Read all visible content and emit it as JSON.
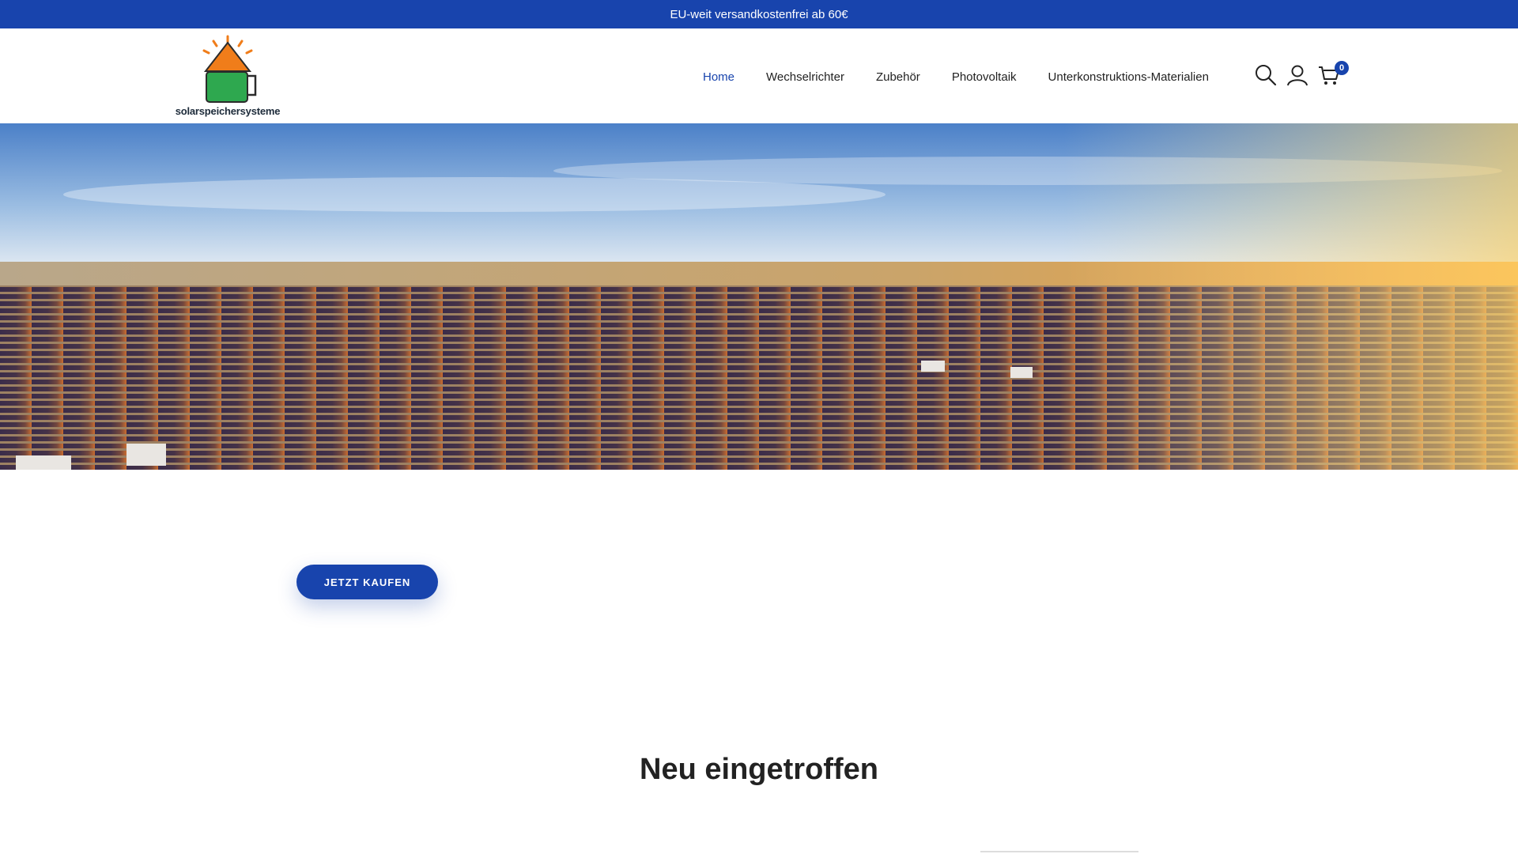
{
  "announcement": "EU-weit versandkostenfrei ab 60€",
  "brand": {
    "name": "solarspeichersysteme",
    "colors": {
      "primary": "#1844ad",
      "roof": "#f07d1a",
      "battery": "#2ea84f"
    }
  },
  "nav": {
    "items": [
      {
        "label": "Home",
        "active": true
      },
      {
        "label": "Wechselrichter"
      },
      {
        "label": "Zubehör"
      },
      {
        "label": "Photovoltaik"
      },
      {
        "label": "Unterkonstruktions-Materialien"
      }
    ]
  },
  "header_icons": {
    "search": "search-icon",
    "account": "user-icon",
    "cart": "cart-icon"
  },
  "cart": {
    "count": "0"
  },
  "hero": {
    "image": "solar-farm-panorama"
  },
  "cta": {
    "label": "JETZT KAUFEN"
  },
  "section": {
    "title": "Neu eingetroffen"
  }
}
